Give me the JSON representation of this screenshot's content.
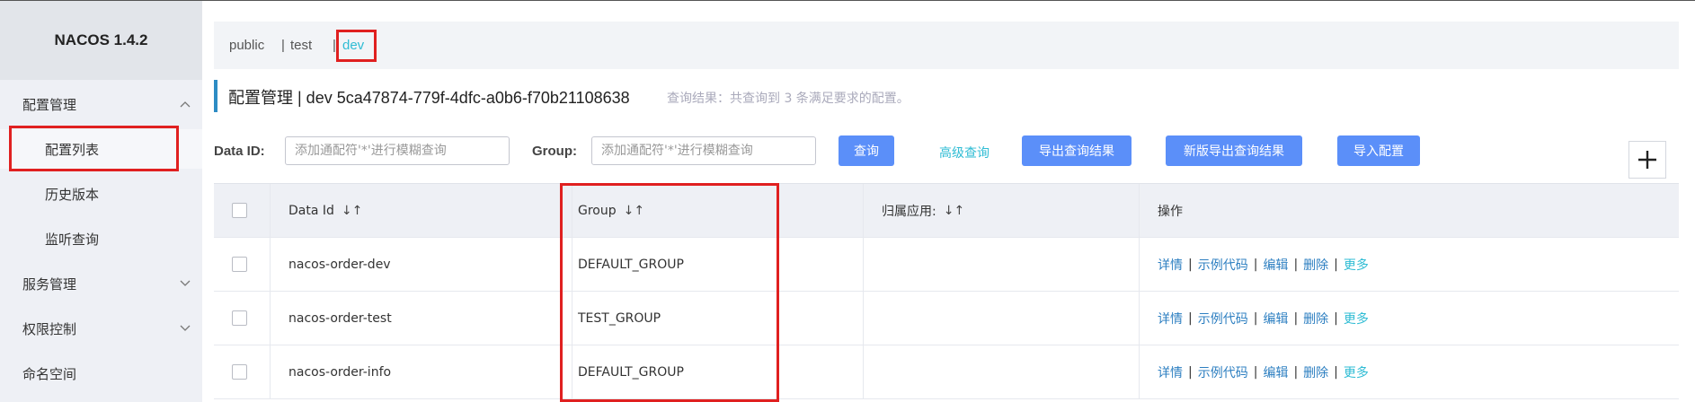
{
  "sidebar": {
    "logo": "NACOS 1.4.2",
    "items": [
      {
        "label": "配置管理",
        "chevron": "^"
      },
      {
        "label": "配置列表"
      },
      {
        "label": "历史版本"
      },
      {
        "label": "监听查询"
      },
      {
        "label": "服务管理",
        "chevron": "v"
      },
      {
        "label": "权限控制",
        "chevron": "v"
      },
      {
        "label": "命名空间"
      }
    ]
  },
  "namespaces": [
    {
      "label": "public"
    },
    {
      "label": "test",
      "prefix": "|"
    },
    {
      "label": "dev",
      "prefix": "|"
    }
  ],
  "header": {
    "title": "配置管理  |  dev  5ca47874-779f-4dfc-a0b6-f70b21108638",
    "hint": "查询结果：共查询到 3 条满足要求的配置。"
  },
  "search": {
    "data_id_label": "Data ID:",
    "data_id_placeholder": "添加通配符'*'进行模糊查询",
    "group_label": "Group:",
    "group_placeholder": "添加通配符'*'进行模糊查询",
    "query_button": "查询",
    "advanced_link": "高级查询",
    "export_button": "导出查询结果",
    "new_export_button": "新版导出查询结果",
    "import_button": "导入配置",
    "add_button": "+"
  },
  "table": {
    "columns": [
      "Data Id",
      "Group",
      "归属应用:",
      "操作"
    ],
    "sort_icon": "↓↑",
    "rows": [
      {
        "data_id": "nacos-order-dev",
        "group": "DEFAULT_GROUP",
        "app": ""
      },
      {
        "data_id": "nacos-order-test",
        "group": "TEST_GROUP",
        "app": ""
      },
      {
        "data_id": "nacos-order-info",
        "group": "DEFAULT_GROUP",
        "app": ""
      }
    ],
    "ops": {
      "detail": "详情",
      "sample": "示例代码",
      "edit": "编辑",
      "delete": "删除",
      "more": "更多",
      "sep": "|"
    }
  },
  "colors": {
    "accent": "#5b8ff9",
    "link": "#2d7fc1",
    "teal": "#2fbcd4",
    "highlight": "#e02020"
  }
}
